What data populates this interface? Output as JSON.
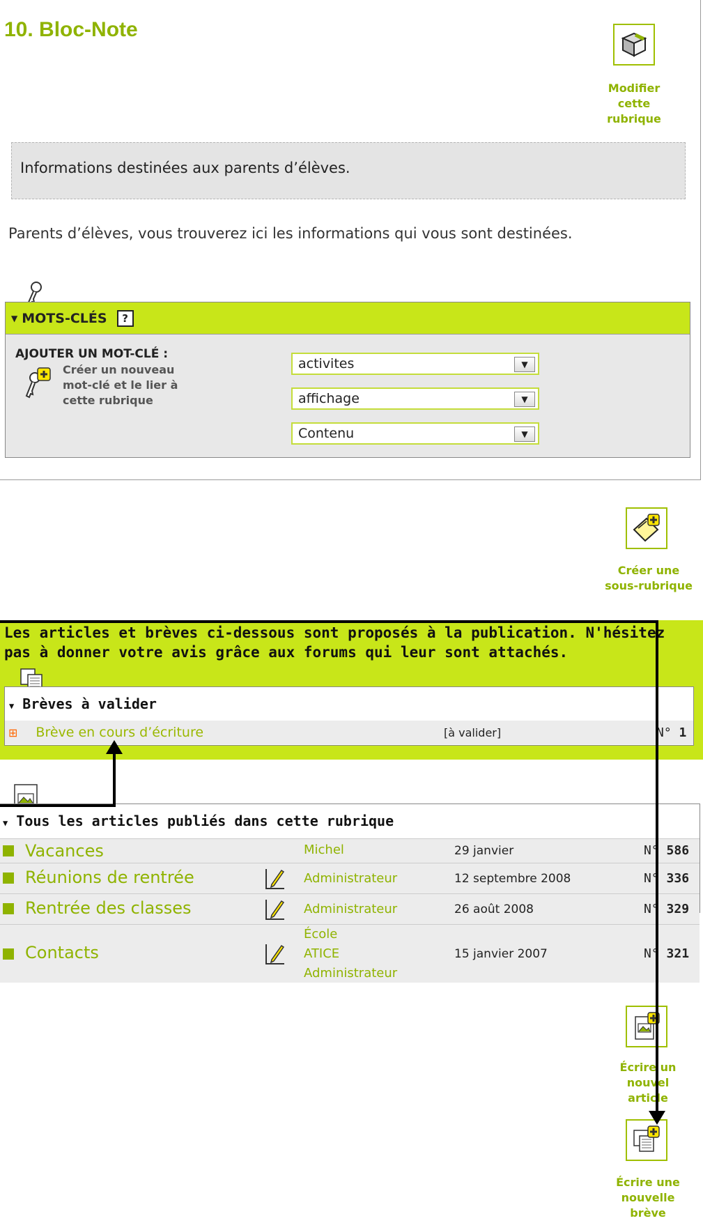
{
  "rubrique": {
    "title": "10. Bloc-Note",
    "modify_label_1": "Modifier",
    "modify_label_2": "cette",
    "modify_label_3": "rubrique",
    "descriptif": "Informations destinées aux parents d’élèves.",
    "texte": "Parents d’élèves, vous trouverez ici les informations qui vous sont destinées."
  },
  "keywords": {
    "header": "MOTS-CLÉS",
    "help": "?",
    "add_title": "AJOUTER UN MOT-CLÉ :",
    "create_1": "Créer un nouveau",
    "create_2": "mot-clé et le lier à",
    "create_3": "cette rubrique",
    "selects": [
      "activites",
      "affichage",
      "Contenu"
    ]
  },
  "create_subrubrique": {
    "label_1": "Créer une",
    "label_2": "sous-rubrique"
  },
  "proposes": {
    "message_1": "Les articles et brèves ci-dessous sont proposés à la publication. N'hésitez",
    "message_2": "pas à donner votre avis grâce aux forums qui leur sont attachés.",
    "breves_header": "Brèves à valider",
    "breve": {
      "title": "Brève en cours d’écriture",
      "status": "[à valider]",
      "num_prefix": "N° ",
      "num": "1"
    }
  },
  "articles": {
    "header": "Tous les articles publiés dans cette rubrique",
    "rows": [
      {
        "title": "Vacances",
        "authors": [
          "Michel"
        ],
        "date": "29 janvier",
        "num_prefix": "N° ",
        "num": "586",
        "edit_icon": false
      },
      {
        "title": "Réunions de rentrée",
        "authors": [
          "Administrateur"
        ],
        "date": "12 septembre 2008",
        "num_prefix": "N° ",
        "num": "336",
        "edit_icon": true
      },
      {
        "title": "Rentrée des classes",
        "authors": [
          "Administrateur"
        ],
        "date": "26 août 2008",
        "num_prefix": "N° ",
        "num": "329",
        "edit_icon": true
      },
      {
        "title": "Contacts",
        "authors": [
          "École",
          "ATICE",
          "Administrateur"
        ],
        "date": "15 janvier 2007",
        "num_prefix": "N° ",
        "num": "321",
        "edit_icon": true
      }
    ]
  },
  "actions": {
    "article_1": "Écrire un",
    "article_2": "nouvel",
    "article_3": "article",
    "breve_1": "Écrire une",
    "breve_2": "nouvelle",
    "breve_3": "brève"
  },
  "colors": {
    "accent": "#8fb300",
    "header_bg": "#c8e619",
    "gray_bg": "#e8e8e8"
  }
}
